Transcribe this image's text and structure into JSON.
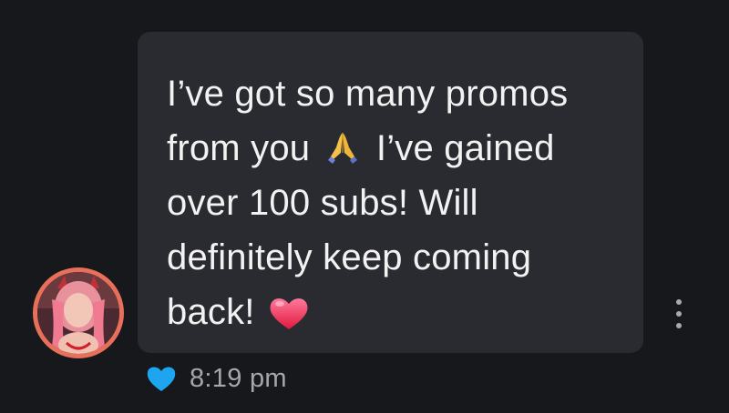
{
  "message": {
    "line_1": "I’ve got so many promos",
    "line_2_before": "from you",
    "line_2_after": "I’ve gained",
    "line_3": "over 100 subs! Will",
    "line_4": "definitely keep coming",
    "line_5": "back!",
    "emoji_1": "folded-hands-icon",
    "emoji_2": "heart-icon"
  },
  "meta": {
    "timestamp": "8:19 pm",
    "like_icon": "blue-heart-icon",
    "like_color": "#1ea5f0"
  },
  "colors": {
    "background": "#17181c",
    "bubble": "#2a2b30",
    "text": "#f2f2f2",
    "avatar_ring": "#e8705a"
  }
}
